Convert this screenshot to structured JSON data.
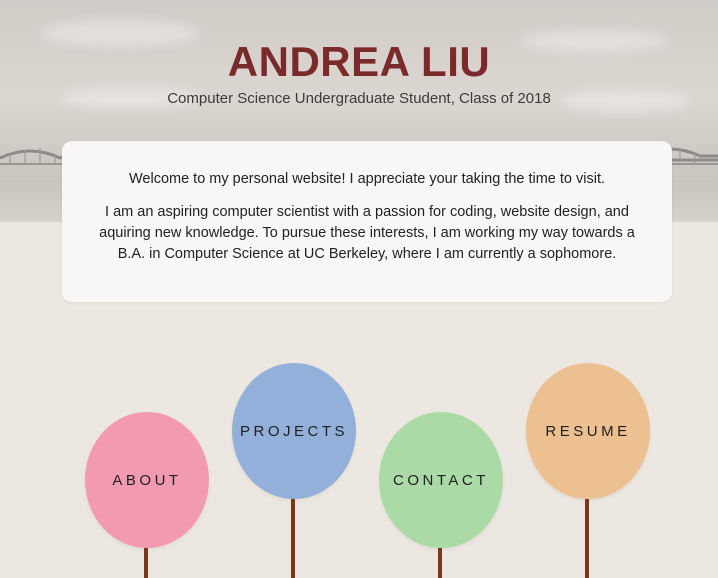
{
  "header": {
    "name": "ANDREA LIU",
    "tagline": "Computer Science Undergraduate Student, Class of 2018"
  },
  "intro": {
    "welcome": "Welcome to my personal website! I appreciate your taking the time to visit.",
    "bio": "I am an aspiring computer scientist with a passion for coding, website design, and aquiring new knowledge. To pursue these interests, I am working my way towards a B.A. in Computer Science at UC Berkeley, where I am currently a sophomore."
  },
  "nav": {
    "about": {
      "label": "ABOUT",
      "color": "#f29bb0"
    },
    "projects": {
      "label": "PROJECTS",
      "color": "#93b0db"
    },
    "contact": {
      "label": "CONTACT",
      "color": "#aadaa6"
    },
    "resume": {
      "label": "RESUME",
      "color": "#ecc090"
    }
  },
  "colors": {
    "title": "#7a2a2a",
    "string": "#7a3a1a",
    "card": "#f8f7f5",
    "page_bg": "#ece7e1"
  }
}
